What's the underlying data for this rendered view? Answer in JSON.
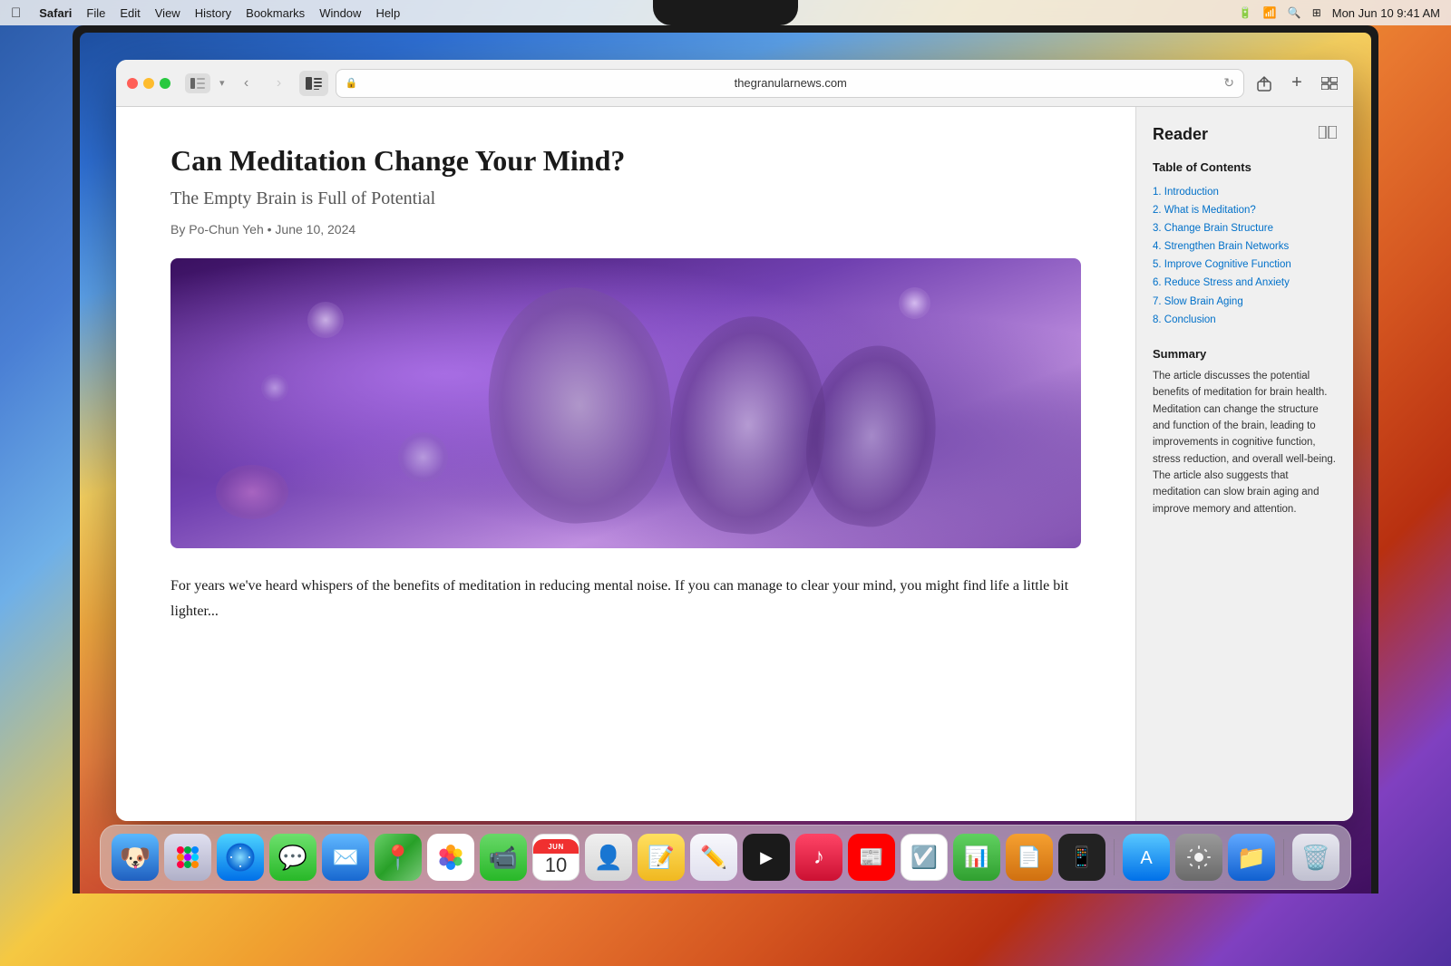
{
  "menubar": {
    "apple": "⌘",
    "app_name": "Safari",
    "items": [
      "File",
      "Edit",
      "View",
      "History",
      "Bookmarks",
      "Window",
      "Help"
    ],
    "battery": "■",
    "wifi": "WiFi",
    "search": "🔍",
    "datetime": "Mon Jun 10  9:41 AM"
  },
  "safari": {
    "address": "thegranularnews.com",
    "back_btn": "‹",
    "forward_btn": "›"
  },
  "article": {
    "title": "Can Meditation Change Your Mind?",
    "subtitle": "The Empty Brain is Full of Potential",
    "byline": "By Po-Chun Yeh  •  June 10, 2024",
    "body_text": "For years we've heard whispers of the benefits of meditation in reducing mental noise. If you can manage to clear your mind, you might find life a little bit lighter..."
  },
  "reader": {
    "panel_title": "Reader",
    "toc_label": "Table of Contents",
    "toc_items": [
      "1. Introduction",
      "2. What is Meditation?",
      "3. Change Brain Structure",
      "4. Strengthen Brain Networks",
      "5. Improve Cognitive Function",
      "6. Reduce Stress and Anxiety",
      "7. Slow Brain Aging",
      "8. Conclusion"
    ],
    "summary_label": "Summary",
    "summary_text": "The article discusses the potential benefits of meditation for brain health. Meditation can change the structure and function of the brain, leading to improvements in cognitive function, stress reduction, and overall well-being. The article also suggests that meditation can slow brain aging and improve memory and attention."
  },
  "dock": {
    "items": [
      {
        "name": "Finder",
        "emoji": "🔵",
        "label": "finder"
      },
      {
        "name": "Launchpad",
        "emoji": "⊞",
        "label": "launchpad"
      },
      {
        "name": "Safari",
        "emoji": "🧭",
        "label": "safari"
      },
      {
        "name": "Messages",
        "emoji": "💬",
        "label": "messages"
      },
      {
        "name": "Mail",
        "emoji": "✉️",
        "label": "mail"
      },
      {
        "name": "Maps",
        "emoji": "🗺️",
        "label": "maps"
      },
      {
        "name": "Photos",
        "emoji": "🖼",
        "label": "photos"
      },
      {
        "name": "FaceTime",
        "emoji": "📹",
        "label": "facetime"
      },
      {
        "name": "Calendar",
        "emoji": "10",
        "label": "calendar"
      },
      {
        "name": "Contacts",
        "emoji": "👤",
        "label": "contacts"
      },
      {
        "name": "Notes",
        "emoji": "📝",
        "label": "notes"
      },
      {
        "name": "Freeform",
        "emoji": "✏️",
        "label": "freeform"
      },
      {
        "name": "Apple TV",
        "emoji": "▶",
        "label": "appletv"
      },
      {
        "name": "Music",
        "emoji": "♪",
        "label": "music"
      },
      {
        "name": "News",
        "emoji": "📰",
        "label": "news"
      },
      {
        "name": "Reminders",
        "emoji": "☑",
        "label": "reminders"
      },
      {
        "name": "Numbers",
        "emoji": "📊",
        "label": "numbers"
      },
      {
        "name": "Pages",
        "emoji": "📄",
        "label": "pages"
      },
      {
        "name": "iPhone Mirroring",
        "emoji": "📱",
        "label": "iphone"
      },
      {
        "name": "App Store",
        "emoji": "A",
        "label": "appstore"
      },
      {
        "name": "System Settings",
        "emoji": "⚙",
        "label": "settings"
      },
      {
        "name": "Finder Window",
        "emoji": "📁",
        "label": "finder2"
      },
      {
        "name": "Trash",
        "emoji": "🗑",
        "label": "trash"
      }
    ]
  }
}
